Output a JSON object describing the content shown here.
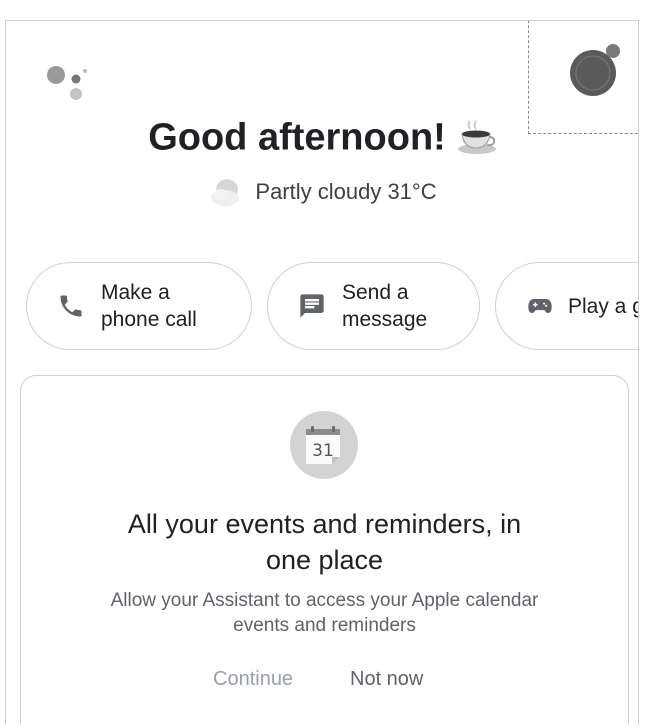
{
  "header": {
    "logo_icon": "google-assistant-dots-icon",
    "avatar_icon": "profile-avatar-icon"
  },
  "greeting": {
    "text": "Good afternoon!",
    "icon": "coffee-cup-icon"
  },
  "weather": {
    "text": "Partly cloudy 31°C",
    "icon": "partly-cloudy-icon"
  },
  "suggestions": [
    {
      "label": "Make a\nphone call",
      "icon": "phone-icon"
    },
    {
      "label": "Send a\nmessage",
      "icon": "message-icon"
    },
    {
      "label": "Play a game",
      "icon": "gamepad-icon"
    }
  ],
  "card": {
    "icon": "calendar-icon",
    "calendar_day": "31",
    "title": "All your events and reminders, in\none place",
    "body": "Allow your Assistant to access your Apple calendar\nevents and reminders",
    "continue_label": "Continue",
    "not_now_label": "Not now"
  }
}
